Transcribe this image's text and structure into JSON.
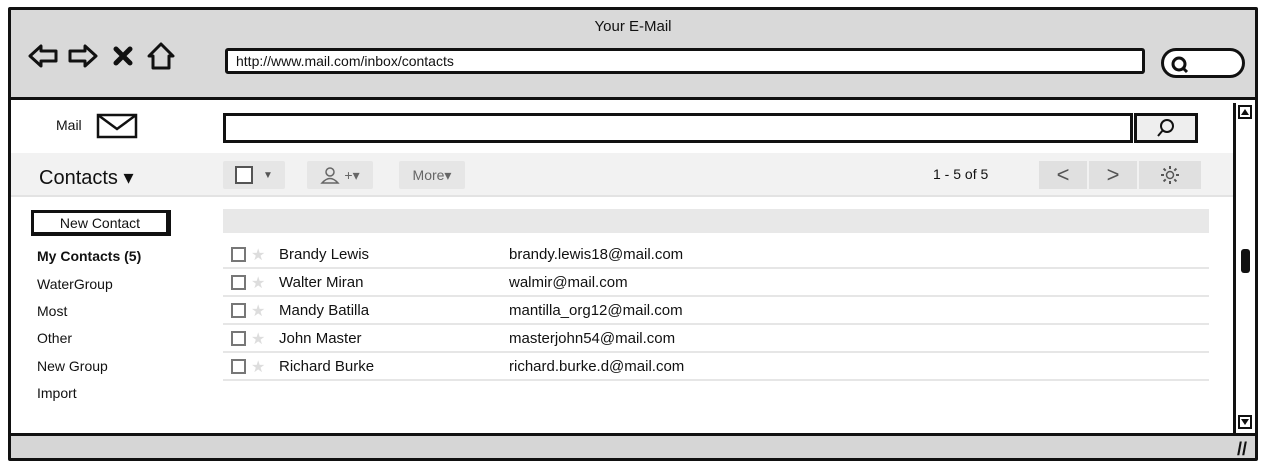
{
  "window": {
    "title": "Your E-Mail"
  },
  "browser": {
    "url": "http://www.mail.com/inbox/contacts",
    "nav_icons": [
      "back-arrow-icon",
      "forward-arrow-icon",
      "stop-x-icon",
      "home-icon"
    ]
  },
  "mailbar": {
    "label": "Mail",
    "search_value": ""
  },
  "toolbar": {
    "contacts_label": "Contacts ▾",
    "more_label": "More▾",
    "add_user_label": "+▾",
    "count": "1 - 5 of 5",
    "prev_label": "<",
    "next_label": ">"
  },
  "sidebar": {
    "new_contact": "New Contact",
    "items": [
      {
        "label": "My Contacts (5)",
        "bold": true
      },
      {
        "label": "WaterGroup"
      },
      {
        "label": "Most"
      },
      {
        "label": "Other"
      },
      {
        "label": "New Group"
      },
      {
        "label": "Import"
      }
    ]
  },
  "contacts": [
    {
      "name": "Brandy Lewis",
      "email": "brandy.lewis18@mail.com"
    },
    {
      "name": "Walter Miran",
      "email": "walmir@mail.com"
    },
    {
      "name": "Mandy Batilla",
      "email": "mantilla_org12@mail.com"
    },
    {
      "name": "John Master",
      "email": "masterjohn54@mail.com"
    },
    {
      "name": "Richard Burke",
      "email": "richard.burke.d@mail.com"
    }
  ]
}
